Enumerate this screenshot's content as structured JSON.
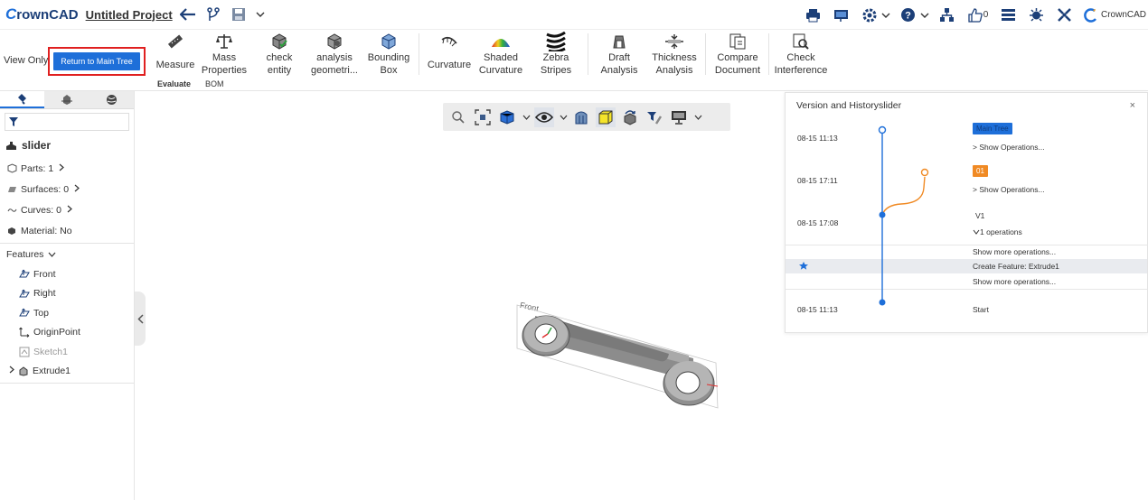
{
  "app": {
    "logo_prefix": "C",
    "logo_rest": "rownCAD",
    "project_title": "Untitled Project",
    "brand_right": "CrownCAD",
    "like_count": "0"
  },
  "ribbon": {
    "view_only": "View Only",
    "return_button": "Return to Main Tree",
    "tools": [
      {
        "label": "Measure",
        "icon": "ruler-icon"
      },
      {
        "label": "Mass\nProperties",
        "icon": "scale-icon"
      },
      {
        "label": "check\nentity",
        "icon": "check-cube-icon"
      },
      {
        "label": "analysis\ngeometri...",
        "icon": "analysis-cube-icon"
      },
      {
        "label": "Bounding\nBox",
        "icon": "bounding-box-icon"
      },
      {
        "label": "Curvature",
        "icon": "curvature-icon"
      },
      {
        "label": "Shaded\nCurvature",
        "icon": "shaded-curvature-icon"
      },
      {
        "label": "Zebra\nStripes",
        "icon": "zebra-icon"
      },
      {
        "label": "Draft\nAnalysis",
        "icon": "draft-analysis-icon"
      },
      {
        "label": "Thickness\nAnalysis",
        "icon": "thickness-icon"
      },
      {
        "label": "Compare\nDocument",
        "icon": "compare-icon"
      },
      {
        "label": "Check\nInterference",
        "icon": "interference-icon"
      }
    ],
    "tabs": [
      "Evaluate",
      "BOM"
    ]
  },
  "left_panel": {
    "root_name": "slider",
    "parts": "Parts: 1",
    "surfaces": "Surfaces: 0",
    "curves": "Curves: 0",
    "material": "Material: No",
    "features_label": "Features",
    "features": [
      "Front",
      "Right",
      "Top",
      "OriginPoint",
      "Sketch1",
      "Extrude1"
    ]
  },
  "history": {
    "title": "Version and Historyslider",
    "close": "×",
    "entries": [
      {
        "time": "08-15 11:13",
        "tag": "Main Tree",
        "sub": "> Show Operations..."
      },
      {
        "time": "08-15 17:11",
        "tag": "01",
        "sub": "> Show Operations..."
      },
      {
        "time": "08-15 17:08",
        "tag": "V1",
        "sub": "1 operations"
      }
    ],
    "show_more_1": "Show more operations...",
    "feature_op": "Create Feature:   Extrude1",
    "show_more_2": "Show more operations...",
    "start_time": "08-15 11:13",
    "start_label": "Start"
  },
  "viewport": {
    "plane_label": "Front"
  },
  "colors": {
    "accent": "#1e6fd9",
    "alert_border": "#e02020",
    "branch_orange": "#f08a24"
  }
}
